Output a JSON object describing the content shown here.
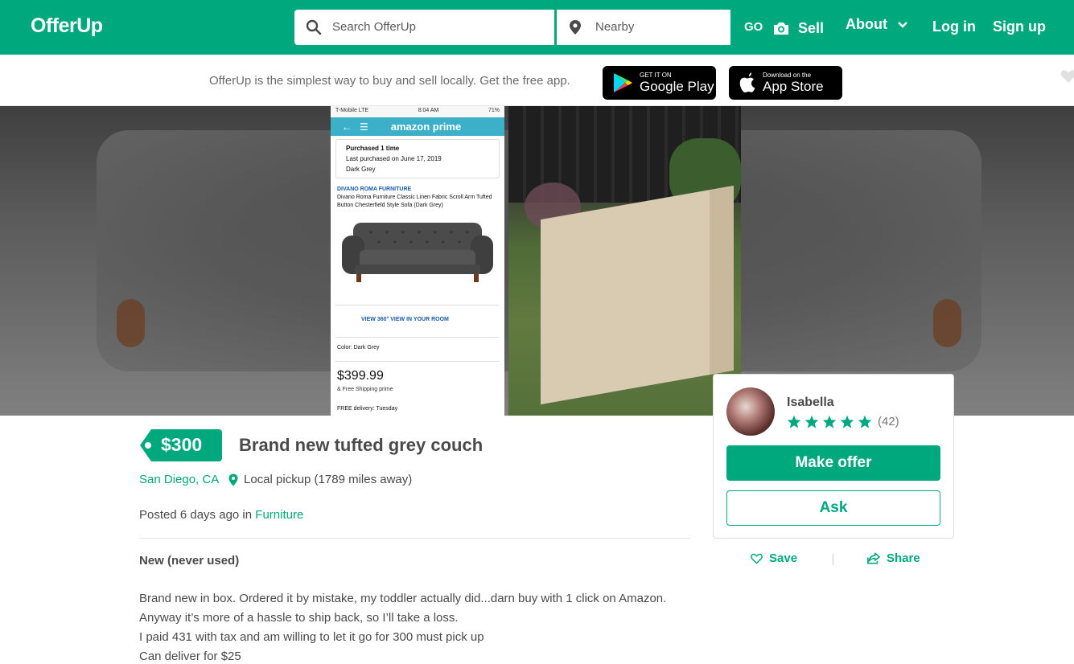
{
  "header": {
    "logo": "OfferUp",
    "search_placeholder": "Search OfferUp",
    "location_placeholder": "Nearby",
    "go_label": "GO",
    "sell_label": "Sell",
    "about_label": "About",
    "login_label": "Log in",
    "signup_label": "Sign up"
  },
  "promo": {
    "text": "OfferUp is the simplest way to buy and sell locally. Get the free app.",
    "google_small": "GET IT ON",
    "google_big": "Google Play",
    "apple_small": "Download on the",
    "apple_big": "App Store"
  },
  "screenshot": {
    "status_left": "T-Mobile  LTE",
    "status_mid": "8:04 AM",
    "status_right": "71%",
    "amazon_brand": "amazon prime",
    "purchased": "Purchased 1 time",
    "last_purchased": "Last purchased on June 17, 2019",
    "variant": "Dark Grey",
    "brand": "DIVANO ROMA FURNITURE",
    "product": "Divano Roma Furniture Classic Linen Fabric Scroll Arm Tufted Button Chesterfield Style Sofa (Dark Grey)",
    "views": "VIEW 360°     VIEW IN YOUR ROOM",
    "color": "Color: Dark Grey",
    "price": "$399.99",
    "shipping": "& Free Shipping  prime",
    "delivery": "FREE delivery: Tuesday"
  },
  "listing": {
    "price": "$300",
    "title": "Brand new tufted grey couch",
    "location": "San Diego, CA",
    "pickup": "Local pickup (1789 miles away)",
    "posted_prefix": "Posted 6 days ago in",
    "category": "Furniture",
    "condition": "New (never used)",
    "description": [
      "Brand new in box. Ordered it by mistake, my toddler actually did...darn buy with 1 click on Amazon.",
      "Anyway it’s more of a hassle to ship back, so I’ll take a loss.",
      "I paid 431 with tax and am willing to let it go for 300 must pick up",
      "Can deliver for $25"
    ]
  },
  "seller": {
    "name": "Isabella",
    "rating_stars": 5,
    "rating_count": "(42)",
    "make_offer_label": "Make offer",
    "ask_label": "Ask"
  },
  "actions": {
    "save_label": "Save",
    "share_label": "Share"
  },
  "colors": {
    "brand": "#00a87e"
  }
}
